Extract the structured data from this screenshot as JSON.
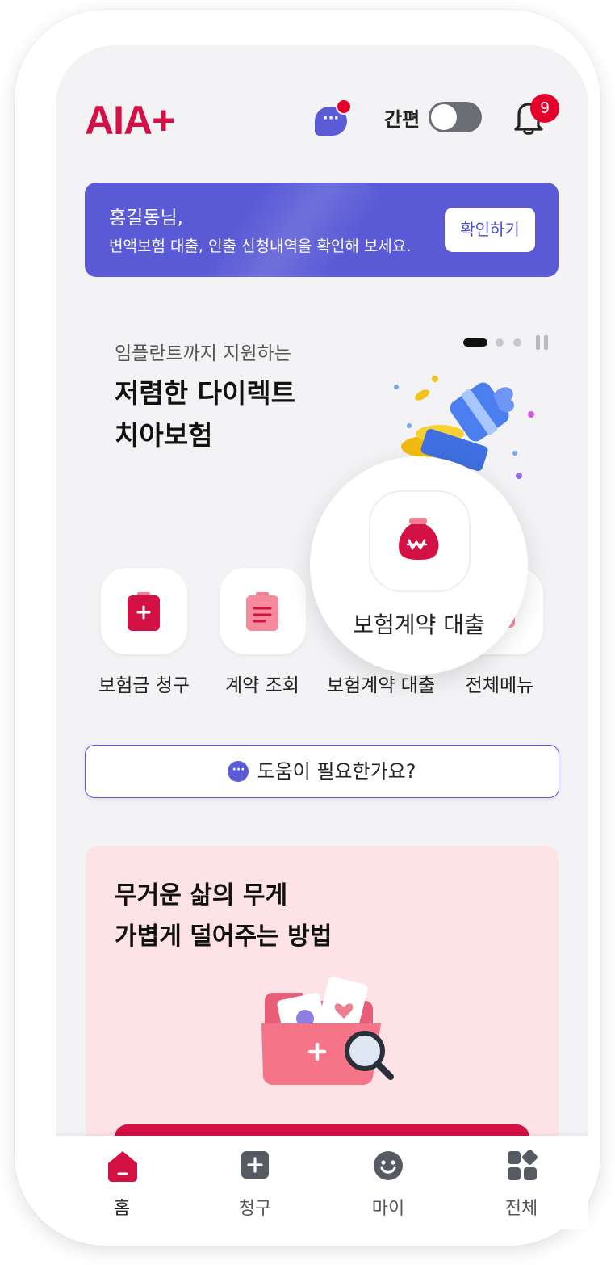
{
  "header": {
    "logo": "AIA+",
    "simple_mode_label": "간편",
    "notification_count": "9",
    "chat_icon_glyph": "···"
  },
  "banner": {
    "greeting": "홍길동님,",
    "message": "변액보험 대출, 인출 신청내역을 확인해 보세요.",
    "button": "확인하기"
  },
  "promo": {
    "subtitle": "임플란트까지 지원하는",
    "title_line1": "저렴한 다이렉트",
    "title_line2": "치아보험",
    "current_slide": 1,
    "total_slides": 3
  },
  "quick_menu": {
    "items": [
      {
        "label": "보험금 청구",
        "icon": "claim-clipboard-icon"
      },
      {
        "label": "계약 조회",
        "icon": "contract-document-icon"
      },
      {
        "label": "보험계약 대출",
        "icon": "loan-money-bag-icon"
      },
      {
        "label": "전체메뉴",
        "icon": "all-menu-icon"
      }
    ],
    "spotlight_label": "보험계약 대출"
  },
  "help": {
    "label": "도움이 필요한가요?",
    "icon_glyph": "···"
  },
  "card": {
    "title_line1": "무거운 삶의 무게",
    "title_line2": "가볍게 덜어주는 방법"
  },
  "bottom_nav": {
    "items": [
      {
        "label": "홈",
        "icon": "home-icon",
        "active": true
      },
      {
        "label": "청구",
        "icon": "claim-plus-icon",
        "active": false
      },
      {
        "label": "마이",
        "icon": "smiley-icon",
        "active": false
      },
      {
        "label": "전체",
        "icon": "grid-icon",
        "active": false
      }
    ]
  },
  "colors": {
    "brand_red": "#d31145",
    "accent_purple": "#5a5ad6",
    "card_pink": "#fde3e6"
  }
}
